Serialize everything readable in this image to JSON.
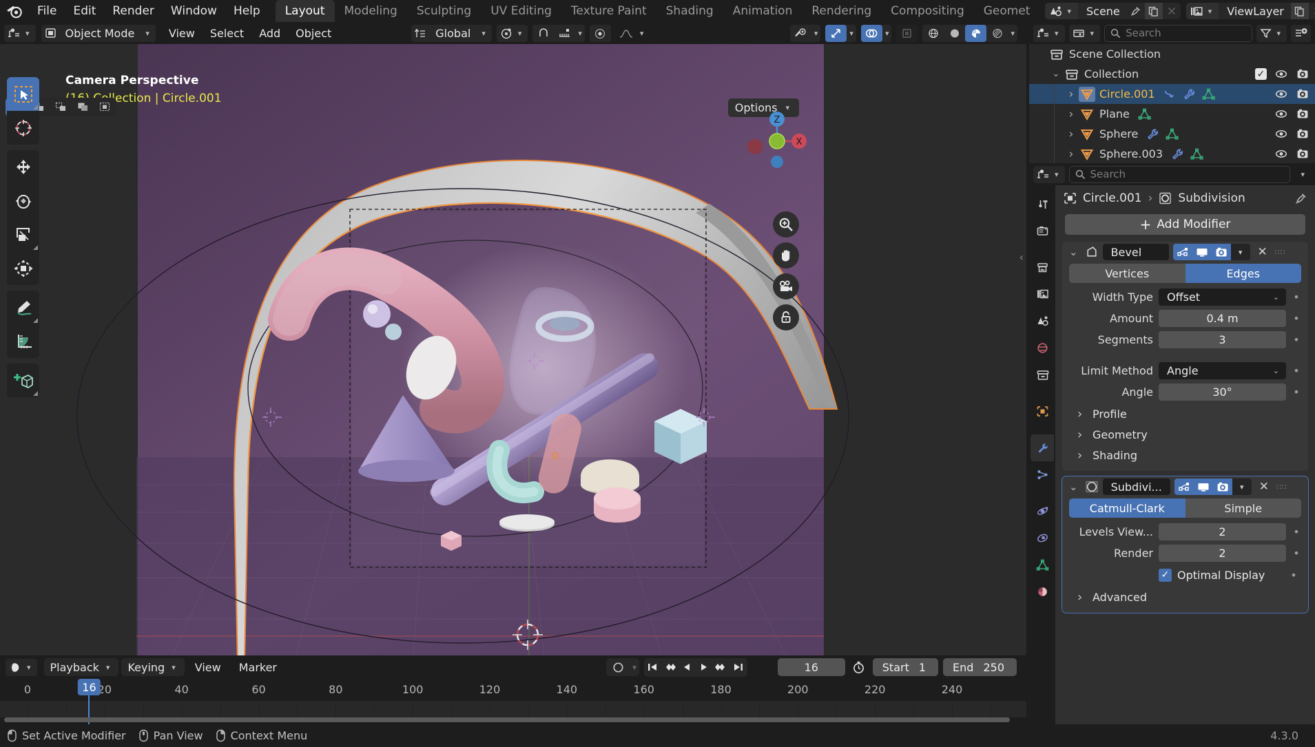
{
  "app": {
    "version": "4.3.0"
  },
  "topbar": {
    "menus": [
      "File",
      "Edit",
      "Render",
      "Window",
      "Help"
    ],
    "workspaces": [
      {
        "label": "Layout",
        "active": true
      },
      {
        "label": "Modeling",
        "active": false
      },
      {
        "label": "Sculpting",
        "active": false
      },
      {
        "label": "UV Editing",
        "active": false
      },
      {
        "label": "Texture Paint",
        "active": false
      },
      {
        "label": "Shading",
        "active": false
      },
      {
        "label": "Animation",
        "active": false
      },
      {
        "label": "Rendering",
        "active": false
      },
      {
        "label": "Compositing",
        "active": false
      },
      {
        "label": "Geomet",
        "active": false
      }
    ],
    "scene": {
      "label": "Scene"
    },
    "viewlayer": {
      "label": "ViewLayer"
    }
  },
  "viewport": {
    "mode": "Object Mode",
    "menus": [
      "View",
      "Select",
      "Add",
      "Object"
    ],
    "orientation": "Global",
    "overlay_line1": "Camera Perspective",
    "overlay_line2": "(16) Collection | Circle.001",
    "options_label": "Options",
    "gizmo_axes": {
      "z": "Z",
      "x": "X"
    }
  },
  "outliner": {
    "search_placeholder": "Search",
    "rows": [
      {
        "label": "Scene Collection",
        "indent": 0,
        "icon": "collection-icon",
        "twisty": "",
        "selected": false,
        "active": false,
        "badges": [],
        "eye": false,
        "camera": false,
        "check": false
      },
      {
        "label": "Collection",
        "indent": 1,
        "icon": "collection-icon",
        "twisty": "down",
        "selected": false,
        "active": false,
        "badges": [],
        "eye": true,
        "camera": true,
        "check": true
      },
      {
        "label": "Circle.001",
        "indent": 2,
        "icon": "mesh-icon",
        "twisty": "right",
        "selected": true,
        "active": true,
        "badges": [
          "animation-icon",
          "modifier-icon",
          "mesh-data-icon"
        ],
        "eye": true,
        "camera": true,
        "check": false
      },
      {
        "label": "Plane",
        "indent": 2,
        "icon": "mesh-icon",
        "twisty": "right",
        "selected": false,
        "active": false,
        "badges": [
          "mesh-data-icon"
        ],
        "eye": true,
        "camera": true,
        "check": false
      },
      {
        "label": "Sphere",
        "indent": 2,
        "icon": "mesh-icon",
        "twisty": "right",
        "selected": false,
        "active": false,
        "badges": [
          "modifier-icon",
          "mesh-data-icon"
        ],
        "eye": true,
        "camera": true,
        "check": false
      },
      {
        "label": "Sphere.003",
        "indent": 2,
        "icon": "mesh-icon",
        "twisty": "right",
        "selected": false,
        "active": false,
        "badges": [
          "modifier-icon",
          "mesh-data-icon"
        ],
        "eye": true,
        "camera": true,
        "check": false
      }
    ]
  },
  "properties": {
    "search_placeholder": "Search",
    "breadcrumb": {
      "object": "Circle.001",
      "modifier": "Subdivision"
    },
    "add_modifier_label": "Add Modifier",
    "tabs": [
      {
        "name": "tool-tab",
        "active": false
      },
      {
        "name": "render-tab",
        "active": false
      },
      {
        "name": "output-tab",
        "active": false
      },
      {
        "name": "view-layer-tab",
        "active": false
      },
      {
        "name": "scene-tab",
        "active": false
      },
      {
        "name": "world-tab",
        "active": false
      },
      {
        "name": "collection-tab",
        "active": false
      },
      {
        "name": "object-tab",
        "active": false
      },
      {
        "name": "modifier-tab",
        "active": true
      },
      {
        "name": "particles-tab",
        "active": false
      },
      {
        "name": "physics-tab",
        "active": false
      },
      {
        "name": "constraints-tab",
        "active": false
      },
      {
        "name": "data-tab",
        "active": false
      },
      {
        "name": "material-tab",
        "active": false
      }
    ],
    "modifiers": [
      {
        "name": "Bevel",
        "active": false,
        "affect": {
          "left": "Vertices",
          "right": "Edges",
          "selected": "Edges"
        },
        "rows": [
          {
            "label": "Width Type",
            "value": "Offset",
            "type": "dropdown"
          },
          {
            "label": "Amount",
            "value": "0.4 m",
            "type": "value"
          },
          {
            "label": "Segments",
            "value": "3",
            "type": "value"
          },
          {
            "label": "",
            "value": "",
            "type": "spacer"
          },
          {
            "label": "Limit Method",
            "value": "Angle",
            "type": "dropdown"
          },
          {
            "label": "Angle",
            "value": "30°",
            "type": "value"
          }
        ],
        "sections": [
          "Profile",
          "Geometry",
          "Shading"
        ]
      },
      {
        "name": "Subdivi...",
        "active": true,
        "affect": {
          "left": "Catmull-Clark",
          "right": "Simple",
          "selected": "Catmull-Clark"
        },
        "rows": [
          {
            "label": "Levels View...",
            "value": "2",
            "type": "value"
          },
          {
            "label": "Render",
            "value": "2",
            "type": "value"
          }
        ],
        "checkbox": {
          "label": "Optimal Display",
          "checked": true
        },
        "sections": [
          "Advanced"
        ]
      }
    ]
  },
  "timeline": {
    "menus_dropdown": [
      "Playback",
      "Keying"
    ],
    "menus_plain": [
      "View",
      "Marker"
    ],
    "current_frame": "16",
    "start_label": "Start",
    "start_value": "1",
    "end_label": "End",
    "end_value": "250",
    "ticks": [
      "0",
      "20",
      "40",
      "60",
      "80",
      "100",
      "120",
      "140",
      "160",
      "180",
      "200",
      "220",
      "240"
    ],
    "playhead_frame": "16"
  },
  "statusbar": {
    "items": [
      {
        "label": "Set Active Modifier",
        "mouse": "left"
      },
      {
        "label": "Pan View",
        "mouse": "middle"
      },
      {
        "label": "Context Menu",
        "mouse": "right"
      }
    ],
    "version": "4.3.0"
  },
  "colors": {
    "accent_blue": "#4772b3",
    "active_orange": "#f5b945",
    "mesh_orange": "#ed9b4b",
    "mesh_data_green": "#3aa87a",
    "modifier_blue": "#6a8fe0"
  }
}
